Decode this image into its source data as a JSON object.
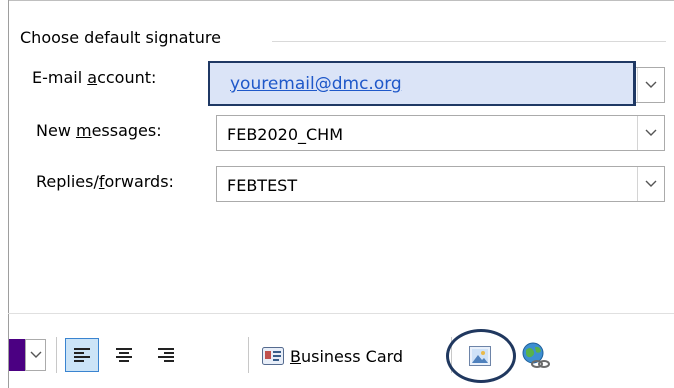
{
  "section": {
    "legend": "Choose default signature"
  },
  "fields": {
    "email_account_label_pre": "E-mail ",
    "email_account_label_u": "a",
    "email_account_label_post": "ccount:",
    "email_account_value": "youremail@dmc.org",
    "new_messages_label_pre": "New ",
    "new_messages_label_u": "m",
    "new_messages_label_post": "essages:",
    "new_messages_value": "FEB2020_CHM",
    "replies_label_pre": "Replies/",
    "replies_label_u": "f",
    "replies_label_post": "orwards:",
    "replies_value": "FEBTEST"
  },
  "toolbar": {
    "business_card_u": "B",
    "business_card_rest": "usiness Card"
  },
  "colors": {
    "highlight_fill": "#dbe4f7",
    "highlight_border": "#1f3864",
    "link": "#1f58c9",
    "circle": "#20385f",
    "font_color_swatch": "#4b0082"
  },
  "icons": {
    "dropdown": "chevron-down-icon",
    "align_left": "align-left-icon",
    "align_center": "align-center-icon",
    "align_right": "align-right-icon",
    "business_card": "business-card-icon",
    "insert_picture": "picture-icon",
    "hyperlink": "hyperlink-icon"
  }
}
